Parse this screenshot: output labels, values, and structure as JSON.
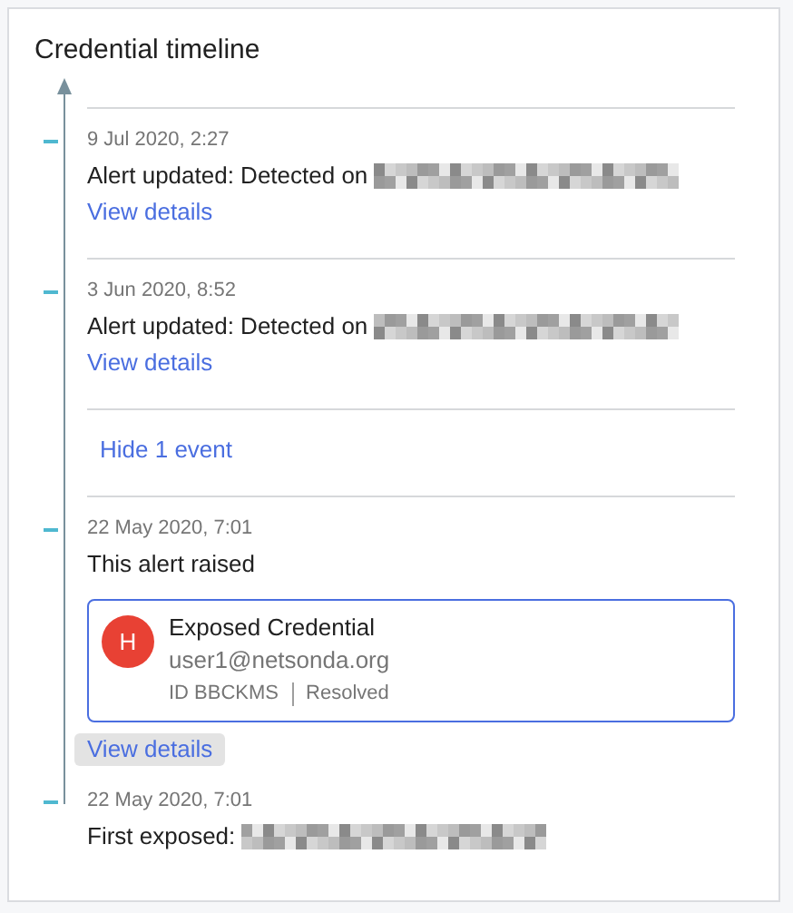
{
  "title": "Credential timeline",
  "entries": [
    {
      "kind": "event",
      "divider": true,
      "date": "9 Jul 2020, 2:27",
      "text": "Alert updated: Detected on",
      "redacted": true,
      "link": {
        "label": "View details",
        "focused": false
      }
    },
    {
      "kind": "event",
      "divider": true,
      "date": "3 Jun 2020, 8:52",
      "text": "Alert updated: Detected on",
      "redacted": true,
      "link": {
        "label": "View details",
        "focused": false
      }
    },
    {
      "kind": "toggle",
      "divider": true,
      "label": "Hide 1 event"
    },
    {
      "kind": "event",
      "divider": true,
      "date": "22 May 2020, 7:01",
      "text": "This alert raised",
      "redacted": false,
      "alert": {
        "initial": "H",
        "title": "Exposed Credential",
        "email": "user1@netsonda.org",
        "id": "ID BBCKMS",
        "status": "Resolved"
      },
      "link": {
        "label": "View details",
        "focused": true
      }
    },
    {
      "kind": "event",
      "divider": false,
      "date": "22 May 2020, 7:01",
      "text": "First exposed:",
      "redacted": true
    }
  ]
}
